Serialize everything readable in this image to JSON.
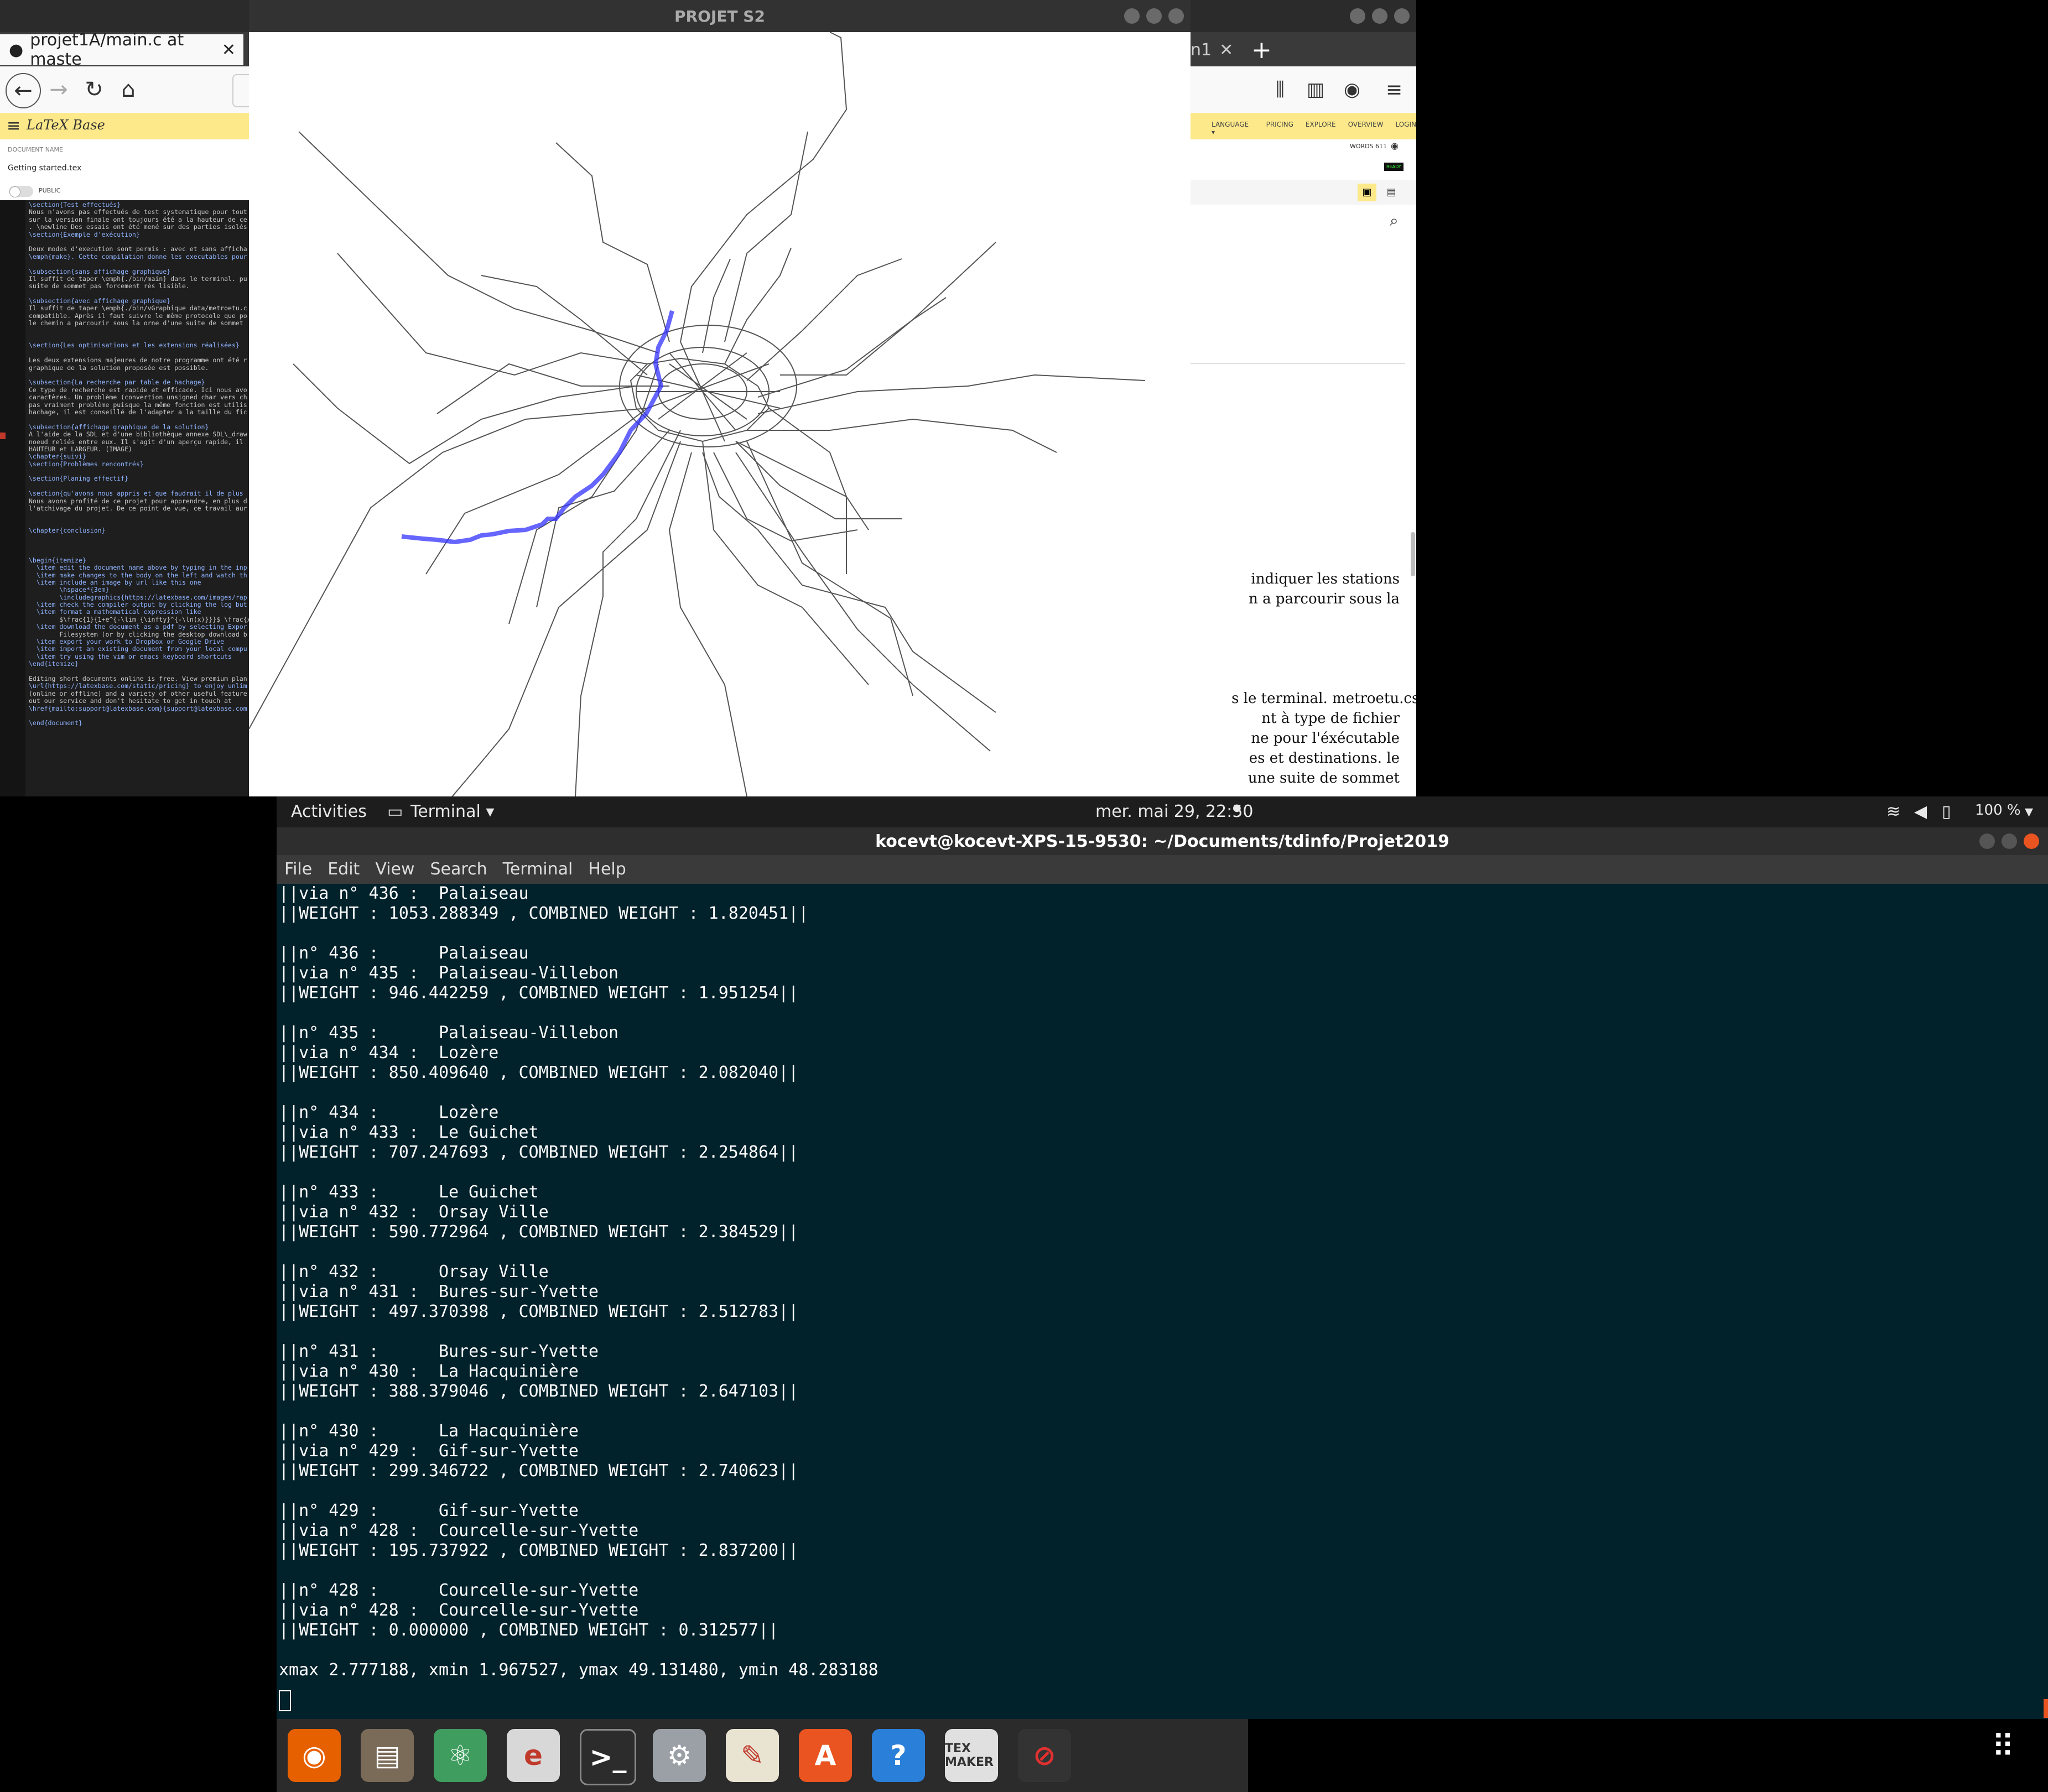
{
  "browser": {
    "tab_title": "projet1A/main.c at maste",
    "tab_title_2": "n1",
    "new_tab": "+",
    "brand": "LaTeX Base",
    "nav_links": [
      "LANGUAGE ▾",
      "PRICING",
      "EXPLORE",
      "OVERVIEW",
      "LOGIN"
    ],
    "words_label": "WORDS",
    "words_count": "611",
    "ready_badge": "READY",
    "document_name_label": "DOCUMENT NAME",
    "document_name": "Getting started.tex",
    "public_label": "PUBLIC",
    "editor_lines": [
      "\\section{Test effectués}",
      "Nous n'avons pas effectués de test systematique pour tout",
      "sur la version finale ont toujours été a la hauteur de ce",
      ". \\newline Des essais ont été mené sur des parties isolés",
      "\\section{Exemple d'exécution}",
      "",
      "Deux modes d'execution sont permis : avec et sans afficha",
      "\\emph{make}. Cette compilation donne les executables pour",
      "",
      "\\subsection{sans affichage graphique}",
      "Il suffit de taper \\emph{./bin/main} dans le terminal. pu",
      "suite de sommet pas forcement rès lisible.",
      "",
      "\\subsection{avec affichage graphique}",
      "Il suffit de taper \\emph{./bin/vGraphique data/metroetu.c",
      "compatible. Après il faut suivre le même protocole que po",
      "le chemin a parcourir sous la orne d'une suite de sommet",
      "",
      "",
      "\\section{Les optimisations et les extensions réalisées}",
      "",
      "Les deux extensions majeures de notre programme ont été r",
      "graphique de la solution proposée est possible.",
      "",
      "\\subsection{La recherche par table de hachage}",
      "Ce type de recherche est rapide et efficace. Ici nous avo",
      "caractères. Un problème (convertion unsigned char vers ch",
      "pas vraiment problème puisque la même fonction est utilis",
      "hachage, il est conseillé de l'adapter a la taille du fic",
      "",
      "\\subsection{affichage graphique de la solution}",
      "A l'aide de la SDL et d'une bibliothèque annexe SDL\\_draw",
      "noeud reliés entre eux. Il s'agit d'un aperçu rapide, il",
      "HAUTEUR et LARGEUR. (IMAGE)",
      "\\chapter{suivi}",
      "\\section{Problèmes rencontrés}",
      "",
      "\\section{Planing effectif}",
      "",
      "\\section{qu'avons nous appris et que faudrait il de plus",
      "Nous avons profité de ce projet pour apprendre, en plus d",
      "l'atchivage du projet. De ce point de vue, ce travail aur",
      "",
      "",
      "\\chapter{conclusion}",
      "",
      "",
      "",
      "\\begin{itemize}",
      "  \\item edit the document name above by typing in the inp",
      "  \\item make changes to the body on the left and watch th",
      "  \\item include an image by url like this one",
      "        \\hspace*{3em}",
      "        \\includegraphics{https://latexbase.com/images/rap",
      "  \\item check the compiler output by clicking the log but",
      "  \\item format a mathematical expression like",
      "        $\\frac{1}{1+e^{-\\lim_{\\infty}^{-\\ln(x)}}}$ \\frac{x",
      "  \\item download the document as a pdf by selecting Expor",
      "        Filesystem (or by clicking the desktop download b",
      "  \\item export your work to Dropbox or Google Drive",
      "  \\item import an existing document from your local compu",
      "  \\item try using the vim or emacs keyboard shortcuts",
      "\\end{itemize}",
      "",
      "Editing short documents online is free. View premium plan",
      "\\url{https://latexbase.com/static/pricing} to enjoy unlim",
      "(online or offline) and a variety of other useful feature",
      "out our service and don't hesitate to get in touch at",
      "\\href{mailto:support@latexbase.com}{support@latexbase.com",
      "",
      "\\end{document}"
    ],
    "pdf_lines": [
      "indiquer les stations",
      "n a parcourir sous la",
      "s le terminal. metroetu.csv",
      "nt à type de fichier",
      "ne pour l'éxécutable",
      "es et destinations. le",
      "une suite de sommet"
    ]
  },
  "graphic_window": {
    "title": "PROJET S2"
  },
  "topbar": {
    "activities": "Activities",
    "app_menu": "Terminal ▾",
    "clock": "mer. mai 29, 22:50",
    "battery": "100 %"
  },
  "terminal": {
    "title": "kocevt@kocevt-XPS-15-9530: ~/Documents/tdinfo/Projet2019",
    "menu": [
      "File",
      "Edit",
      "View",
      "Search",
      "Terminal",
      "Help"
    ],
    "lines": [
      "||via n° 436 :  Palaiseau",
      "||WEIGHT : 1053.288349 , COMBINED WEIGHT : 1.820451||",
      "",
      "||n° 436 :      Palaiseau",
      "||via n° 435 :  Palaiseau-Villebon",
      "||WEIGHT : 946.442259 , COMBINED WEIGHT : 1.951254||",
      "",
      "||n° 435 :      Palaiseau-Villebon",
      "||via n° 434 :  Lozère",
      "||WEIGHT : 850.409640 , COMBINED WEIGHT : 2.082040||",
      "",
      "||n° 434 :      Lozère",
      "||via n° 433 :  Le Guichet",
      "||WEIGHT : 707.247693 , COMBINED WEIGHT : 2.254864||",
      "",
      "||n° 433 :      Le Guichet",
      "||via n° 432 :  Orsay Ville",
      "||WEIGHT : 590.772964 , COMBINED WEIGHT : 2.384529||",
      "",
      "||n° 432 :      Orsay Ville",
      "||via n° 431 :  Bures-sur-Yvette",
      "||WEIGHT : 497.370398 , COMBINED WEIGHT : 2.512783||",
      "",
      "||n° 431 :      Bures-sur-Yvette",
      "||via n° 430 :  La Hacquinière",
      "||WEIGHT : 388.379046 , COMBINED WEIGHT : 2.647103||",
      "",
      "||n° 430 :      La Hacquinière",
      "||via n° 429 :  Gif-sur-Yvette",
      "||WEIGHT : 299.346722 , COMBINED WEIGHT : 2.740623||",
      "",
      "||n° 429 :      Gif-sur-Yvette",
      "||via n° 428 :  Courcelle-sur-Yvette",
      "||WEIGHT : 195.737922 , COMBINED WEIGHT : 2.837200||",
      "",
      "||n° 428 :      Courcelle-sur-Yvette",
      "||via n° 428 :  Courcelle-sur-Yvette",
      "||WEIGHT : 0.000000 , COMBINED WEIGHT : 0.312577||",
      "",
      "xmax 2.777188, xmin 1.967527, ymax 49.131480, ymin 48.283188"
    ]
  },
  "dock": {
    "apps": [
      {
        "name": "firefox-icon",
        "color": "#e66000"
      },
      {
        "name": "files-icon",
        "color": "#7a6a58"
      },
      {
        "name": "atom-icon",
        "color": "#3f9e5f"
      },
      {
        "name": "evince-icon",
        "color": "#d8d8d8"
      },
      {
        "name": "terminal-icon",
        "color": "#2c2c2c"
      },
      {
        "name": "settings-icon",
        "color": "#9aa0a6"
      },
      {
        "name": "text-editor-icon",
        "color": "#e9e4d2"
      },
      {
        "name": "software-icon",
        "color": "#e95420"
      },
      {
        "name": "help-icon",
        "color": "#2a7fd8"
      },
      {
        "name": "texmaker-icon",
        "color": "#e0e0e0"
      },
      {
        "name": "blocked-app-icon",
        "color": "#333333"
      }
    ],
    "tex_label": "TEX MAKER"
  },
  "colors": {
    "terminal_bg": "#01212b",
    "path_highlight": "#3333ff",
    "latex_header": "#fde98a"
  }
}
